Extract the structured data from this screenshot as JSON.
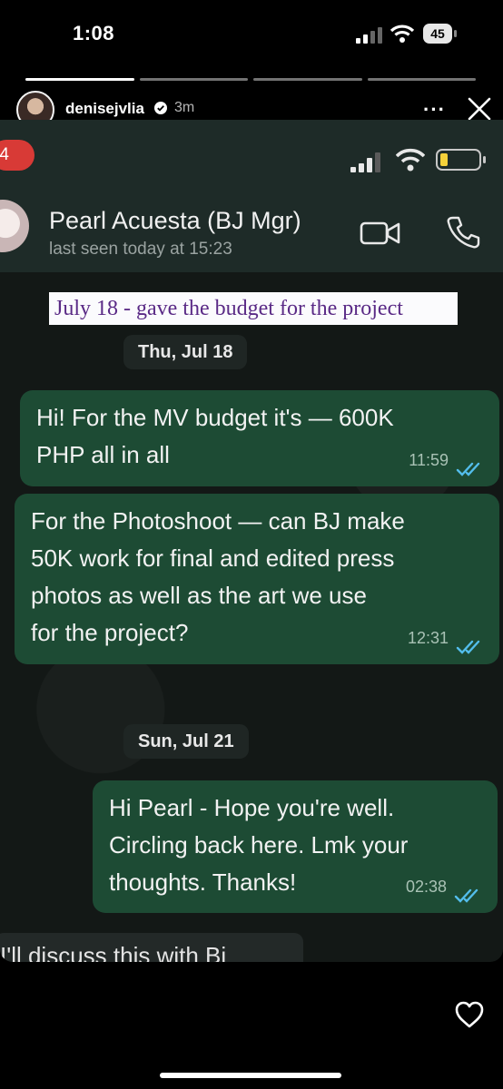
{
  "status_bar": {
    "time": "1:08",
    "battery": "45"
  },
  "story": {
    "username": "denisejvlia",
    "time_ago": "3m",
    "more_label": "···",
    "progress": {
      "segments": 4,
      "completed": 1
    }
  },
  "screenshot": {
    "unread_badge": "4",
    "contact": {
      "name": "Pearl Acuesta (BJ Mgr)",
      "last_seen": "last seen today at 15:23"
    },
    "note_overlay": "July 18 - gave the budget for the project",
    "messages": [
      {
        "date_separator": "Thu, Jul 18"
      },
      {
        "lines": [
          "Hi! For the MV budget it's — 600K",
          "PHP all in all"
        ],
        "time": "11:59"
      },
      {
        "lines": [
          "For the Photoshoot — can BJ make",
          "50K work for final and edited press",
          "photos as well as the art we use",
          "for the project?"
        ],
        "time": "12:31"
      },
      {
        "date_separator": "Sun, Jul 21"
      },
      {
        "lines": [
          "Hi Pearl - Hope you're well.",
          "Circling back here. Lmk your",
          "thoughts. Thanks!"
        ],
        "time": "02:38"
      }
    ],
    "partial_message": "I'll discuss this with Bj"
  },
  "colors": {
    "outgoing_bubble": "#1d4b34",
    "badge": "#d83a36",
    "note_text": "#5a2a86",
    "read_ticks": "#53bdeb"
  }
}
